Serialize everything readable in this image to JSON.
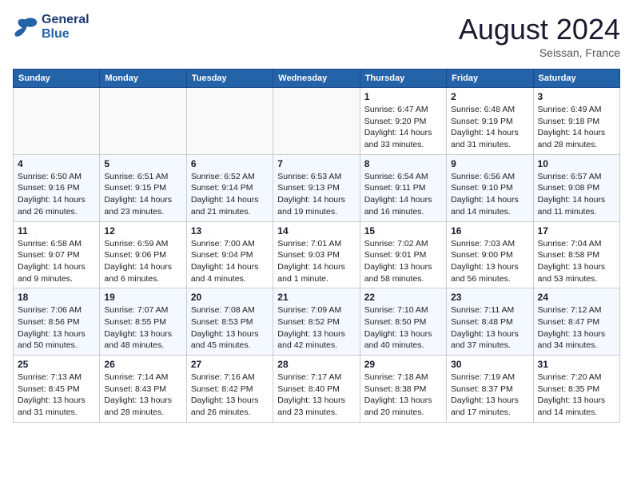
{
  "header": {
    "logo_line1": "General",
    "logo_line2": "Blue",
    "month": "August 2024",
    "location": "Seissan, France"
  },
  "days_of_week": [
    "Sunday",
    "Monday",
    "Tuesday",
    "Wednesday",
    "Thursday",
    "Friday",
    "Saturday"
  ],
  "weeks": [
    [
      {
        "day": "",
        "info": ""
      },
      {
        "day": "",
        "info": ""
      },
      {
        "day": "",
        "info": ""
      },
      {
        "day": "",
        "info": ""
      },
      {
        "day": "1",
        "info": "Sunrise: 6:47 AM\nSunset: 9:20 PM\nDaylight: 14 hours\nand 33 minutes."
      },
      {
        "day": "2",
        "info": "Sunrise: 6:48 AM\nSunset: 9:19 PM\nDaylight: 14 hours\nand 31 minutes."
      },
      {
        "day": "3",
        "info": "Sunrise: 6:49 AM\nSunset: 9:18 PM\nDaylight: 14 hours\nand 28 minutes."
      }
    ],
    [
      {
        "day": "4",
        "info": "Sunrise: 6:50 AM\nSunset: 9:16 PM\nDaylight: 14 hours\nand 26 minutes."
      },
      {
        "day": "5",
        "info": "Sunrise: 6:51 AM\nSunset: 9:15 PM\nDaylight: 14 hours\nand 23 minutes."
      },
      {
        "day": "6",
        "info": "Sunrise: 6:52 AM\nSunset: 9:14 PM\nDaylight: 14 hours\nand 21 minutes."
      },
      {
        "day": "7",
        "info": "Sunrise: 6:53 AM\nSunset: 9:13 PM\nDaylight: 14 hours\nand 19 minutes."
      },
      {
        "day": "8",
        "info": "Sunrise: 6:54 AM\nSunset: 9:11 PM\nDaylight: 14 hours\nand 16 minutes."
      },
      {
        "day": "9",
        "info": "Sunrise: 6:56 AM\nSunset: 9:10 PM\nDaylight: 14 hours\nand 14 minutes."
      },
      {
        "day": "10",
        "info": "Sunrise: 6:57 AM\nSunset: 9:08 PM\nDaylight: 14 hours\nand 11 minutes."
      }
    ],
    [
      {
        "day": "11",
        "info": "Sunrise: 6:58 AM\nSunset: 9:07 PM\nDaylight: 14 hours\nand 9 minutes."
      },
      {
        "day": "12",
        "info": "Sunrise: 6:59 AM\nSunset: 9:06 PM\nDaylight: 14 hours\nand 6 minutes."
      },
      {
        "day": "13",
        "info": "Sunrise: 7:00 AM\nSunset: 9:04 PM\nDaylight: 14 hours\nand 4 minutes."
      },
      {
        "day": "14",
        "info": "Sunrise: 7:01 AM\nSunset: 9:03 PM\nDaylight: 14 hours\nand 1 minute."
      },
      {
        "day": "15",
        "info": "Sunrise: 7:02 AM\nSunset: 9:01 PM\nDaylight: 13 hours\nand 58 minutes."
      },
      {
        "day": "16",
        "info": "Sunrise: 7:03 AM\nSunset: 9:00 PM\nDaylight: 13 hours\nand 56 minutes."
      },
      {
        "day": "17",
        "info": "Sunrise: 7:04 AM\nSunset: 8:58 PM\nDaylight: 13 hours\nand 53 minutes."
      }
    ],
    [
      {
        "day": "18",
        "info": "Sunrise: 7:06 AM\nSunset: 8:56 PM\nDaylight: 13 hours\nand 50 minutes."
      },
      {
        "day": "19",
        "info": "Sunrise: 7:07 AM\nSunset: 8:55 PM\nDaylight: 13 hours\nand 48 minutes."
      },
      {
        "day": "20",
        "info": "Sunrise: 7:08 AM\nSunset: 8:53 PM\nDaylight: 13 hours\nand 45 minutes."
      },
      {
        "day": "21",
        "info": "Sunrise: 7:09 AM\nSunset: 8:52 PM\nDaylight: 13 hours\nand 42 minutes."
      },
      {
        "day": "22",
        "info": "Sunrise: 7:10 AM\nSunset: 8:50 PM\nDaylight: 13 hours\nand 40 minutes."
      },
      {
        "day": "23",
        "info": "Sunrise: 7:11 AM\nSunset: 8:48 PM\nDaylight: 13 hours\nand 37 minutes."
      },
      {
        "day": "24",
        "info": "Sunrise: 7:12 AM\nSunset: 8:47 PM\nDaylight: 13 hours\nand 34 minutes."
      }
    ],
    [
      {
        "day": "25",
        "info": "Sunrise: 7:13 AM\nSunset: 8:45 PM\nDaylight: 13 hours\nand 31 minutes."
      },
      {
        "day": "26",
        "info": "Sunrise: 7:14 AM\nSunset: 8:43 PM\nDaylight: 13 hours\nand 28 minutes."
      },
      {
        "day": "27",
        "info": "Sunrise: 7:16 AM\nSunset: 8:42 PM\nDaylight: 13 hours\nand 26 minutes."
      },
      {
        "day": "28",
        "info": "Sunrise: 7:17 AM\nSunset: 8:40 PM\nDaylight: 13 hours\nand 23 minutes."
      },
      {
        "day": "29",
        "info": "Sunrise: 7:18 AM\nSunset: 8:38 PM\nDaylight: 13 hours\nand 20 minutes."
      },
      {
        "day": "30",
        "info": "Sunrise: 7:19 AM\nSunset: 8:37 PM\nDaylight: 13 hours\nand 17 minutes."
      },
      {
        "day": "31",
        "info": "Sunrise: 7:20 AM\nSunset: 8:35 PM\nDaylight: 13 hours\nand 14 minutes."
      }
    ]
  ]
}
